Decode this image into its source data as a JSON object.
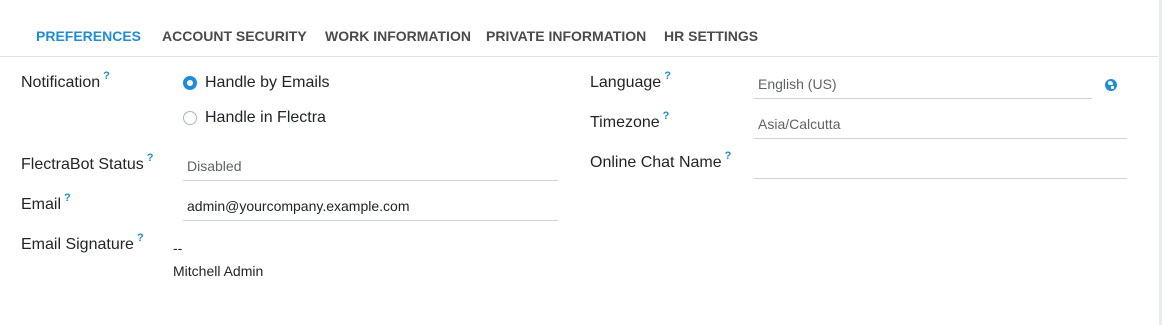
{
  "tabs": [
    {
      "label": "PREFERENCES",
      "active": true
    },
    {
      "label": "ACCOUNT SECURITY",
      "active": false
    },
    {
      "label": "WORK INFORMATION",
      "active": false
    },
    {
      "label": "PRIVATE INFORMATION",
      "active": false
    },
    {
      "label": "HR SETTINGS",
      "active": false
    }
  ],
  "left": {
    "notification_label": "Notification",
    "notification_options": [
      {
        "label": "Handle by Emails",
        "selected": true
      },
      {
        "label": "Handle in Flectra",
        "selected": false
      }
    ],
    "bot_status_label": "FlectraBot Status",
    "bot_status_value": "Disabled",
    "email_label": "Email",
    "email_value": "admin@yourcompany.example.com",
    "signature_label": "Email Signature",
    "signature_lines": [
      "--",
      "Mitchell Admin"
    ]
  },
  "right": {
    "language_label": "Language",
    "language_value": "English (US)",
    "timezone_label": "Timezone",
    "timezone_value": "Asia/Calcutta",
    "chat_name_label": "Online Chat Name",
    "chat_name_value": ""
  },
  "help_marker": "?",
  "icons": {
    "language_action": "globe-icon"
  },
  "colors": {
    "accent": "#1f8dd6",
    "text": "#212529",
    "muted": "#5f6368",
    "border": "#ced4da"
  }
}
